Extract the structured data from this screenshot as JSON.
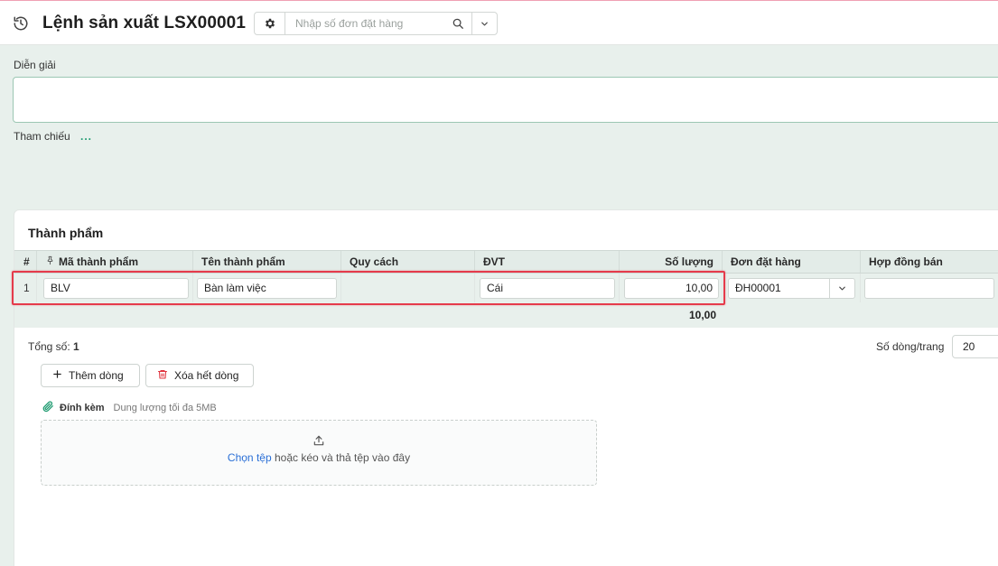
{
  "header": {
    "title": "Lệnh sản xuất LSX00001",
    "search_placeholder": "Nhập số đơn đặt hàng"
  },
  "form": {
    "description_label": "Diễn giải",
    "description_value": "",
    "reference_label": "Tham chiếu",
    "reference_value": "..."
  },
  "products": {
    "section_title": "Thành phẩm",
    "columns": [
      "#",
      "Mã thành phẩm",
      "Tên thành phẩm",
      "Quy cách",
      "ĐVT",
      "Số lượng",
      "Đơn đặt hàng",
      "Hợp đồng bán"
    ],
    "rows": [
      {
        "index": "1",
        "code": "BLV",
        "name": "Bàn làm việc",
        "spec": "",
        "unit": "Cái",
        "quantity": "10,00",
        "order": "ĐH00001",
        "contract": ""
      }
    ],
    "quantity_total": "10,00",
    "total_label": "Tổng số:",
    "total_count": "1",
    "rows_per_page_label": "Số dòng/trang",
    "rows_per_page_value": "20"
  },
  "actions": {
    "add_row": "Thêm dòng",
    "delete_all": "Xóa hết dòng"
  },
  "attachments": {
    "label": "Đính kèm",
    "limit_hint": "Dung lượng tối đa 5MB",
    "choose_file": "Chọn tệp",
    "drop_hint": "hoặc kéo và thả tệp vào đây"
  },
  "colors": {
    "accent": "#1e9a70",
    "highlight_border": "#e53b4b",
    "link": "#2a6fd6",
    "delete_icon": "#e0353f"
  }
}
